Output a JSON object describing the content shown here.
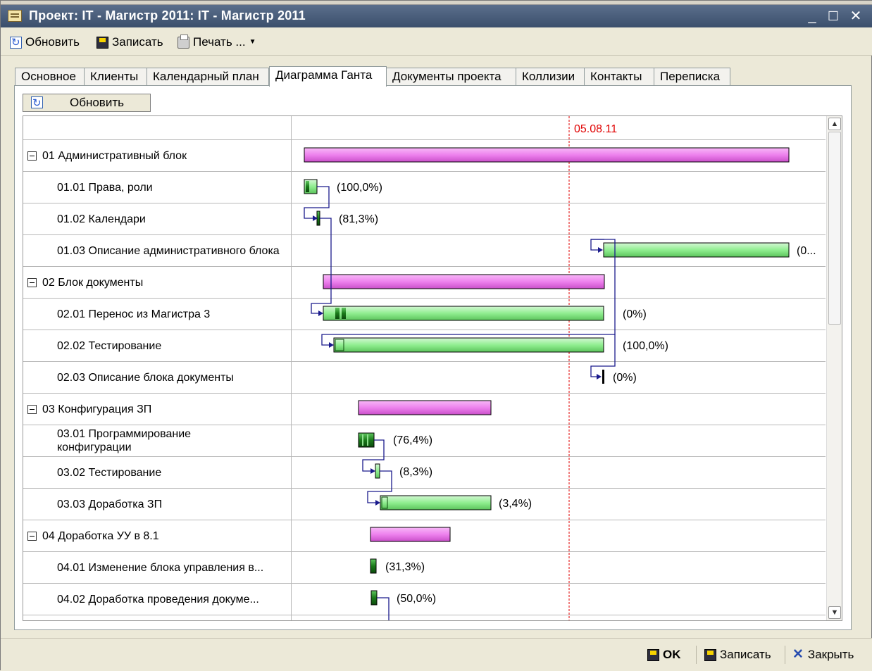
{
  "window": {
    "title": "Проект: IT - Магистр 2011: IT - Магистр 2011",
    "minimize": "_",
    "maximize": "☐",
    "close": "✕"
  },
  "toolbar": {
    "refresh_label": "Обновить",
    "save_label": "Записать",
    "print_label": "Печать ..."
  },
  "tabs": [
    {
      "label": "Основное"
    },
    {
      "label": "Клиенты"
    },
    {
      "label": "Календарный план"
    },
    {
      "label": "Диаграмма Ганта",
      "active": true
    },
    {
      "label": "Документы проекта"
    },
    {
      "label": "Коллизии"
    },
    {
      "label": "Контакты"
    },
    {
      "label": "Переписка"
    }
  ],
  "gantt": {
    "refresh_button_label": "Обновить",
    "today_marker": "05.08.11",
    "colors": {
      "group_bar": "#ee82ee",
      "task_bar": "#90ee90",
      "progress": "#1a7a1a",
      "link": "#1a1a8c",
      "today": "#e00000"
    },
    "rows": [
      {
        "name": "01 Административный блок",
        "group": true
      },
      {
        "name": "01.01 Права, роли",
        "pct": "(100,0%)"
      },
      {
        "name": "01.02 Календари",
        "pct": "(81,3%)"
      },
      {
        "name": "01.03 Описание административного блока",
        "pct": "(0..."
      },
      {
        "name": "02 Блок документы",
        "group": true
      },
      {
        "name": "02.01 Перенос из Магистра 3",
        "pct": "(0%)"
      },
      {
        "name": "02.02 Тестирование",
        "pct": "(100,0%)"
      },
      {
        "name": "02.03 Описание блока документы",
        "pct": "(0%)"
      },
      {
        "name": "03 Конфигурация ЗП",
        "group": true
      },
      {
        "name": "03.01 Программирование конфигурации",
        "pct": "(76,4%)"
      },
      {
        "name": "03.02 Тестирование",
        "pct": "(8,3%)"
      },
      {
        "name": "03.03 Доработка ЗП",
        "pct": "(3,4%)"
      },
      {
        "name": "04 Доработка УУ в 8.1",
        "group": true
      },
      {
        "name": "04.01 Изменение блока управления в...",
        "pct": "(31,3%)"
      },
      {
        "name": "04.02 Доработка проведения докуме...",
        "pct": "(50,0%)"
      }
    ]
  },
  "statusbar": {
    "ok_label": "OK",
    "save_label": "Записать",
    "close_label": "Закрыть"
  }
}
